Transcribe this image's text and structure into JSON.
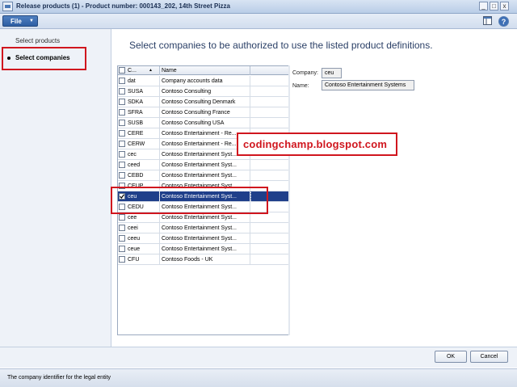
{
  "window": {
    "title": "Release products (1) - Product number: 000143_202, 14th Street Pizza",
    "minimize": "_",
    "maximize": "□",
    "close": "x"
  },
  "menubar": {
    "file_label": "File",
    "file_arrow": "▼",
    "layout_icon": "layout-icon",
    "help_icon": "?"
  },
  "nav": {
    "items": [
      {
        "label": "Select products"
      },
      {
        "label": "Select companies",
        "active": true
      }
    ]
  },
  "heading": "Select companies to be authorized to use the listed product definitions.",
  "grid": {
    "columns": [
      "C...",
      "Name"
    ],
    "sort_indicator": "▲",
    "rows": [
      {
        "code": "dat",
        "name": "Company accounts data",
        "checked": false
      },
      {
        "code": "SUSA",
        "name": "Contoso Consulting",
        "checked": false
      },
      {
        "code": "SDKA",
        "name": "Contoso Consulting Denmark",
        "checked": false
      },
      {
        "code": "SFRA",
        "name": "Contoso Consulting France",
        "checked": false
      },
      {
        "code": "SUSB",
        "name": "Contoso Consulting USA",
        "checked": false
      },
      {
        "code": "CERE",
        "name": "Contoso Entertainment - Re...",
        "checked": false
      },
      {
        "code": "CERW",
        "name": "Contoso Entertainment - Re...",
        "checked": false
      },
      {
        "code": "cec",
        "name": "Contoso Entertainment Syst...",
        "checked": false
      },
      {
        "code": "ceed",
        "name": "Contoso Entertainment Syst...",
        "checked": false
      },
      {
        "code": "CEBD",
        "name": "Contoso Entertainment Syst...",
        "checked": false
      },
      {
        "code": "CEUP",
        "name": "Contoso Entertainment Syst...",
        "checked": false
      },
      {
        "code": "ceu",
        "name": "Contoso Entertainment Syst...",
        "checked": true,
        "selected": true
      },
      {
        "code": "CEDU",
        "name": "Contoso Entertainment Syst...",
        "checked": false
      },
      {
        "code": "cee",
        "name": "Contoso Entertainment Syst...",
        "checked": false
      },
      {
        "code": "ceei",
        "name": "Contoso Entertainment Syst...",
        "checked": false
      },
      {
        "code": "ceeu",
        "name": "Contoso Entertainment Syst...",
        "checked": false
      },
      {
        "code": "ceue",
        "name": "Contoso Entertainment Syst...",
        "checked": false
      },
      {
        "code": "CFU",
        "name": "Contoso Foods - UK",
        "checked": false
      }
    ]
  },
  "details": {
    "company_label": "Company:",
    "company_value": "ceu",
    "name_label": "Name:",
    "name_value": "Contoso Entertainment Systems"
  },
  "watermark": "codingchamp.blogspot.com",
  "buttons": {
    "ok": "OK",
    "cancel": "Cancel"
  },
  "status": "The company identifier for the legal entity",
  "colors": {
    "highlight_red": "#d0161e",
    "selected_row": "#1f3f8a",
    "file_button": "#2d5ea3"
  }
}
